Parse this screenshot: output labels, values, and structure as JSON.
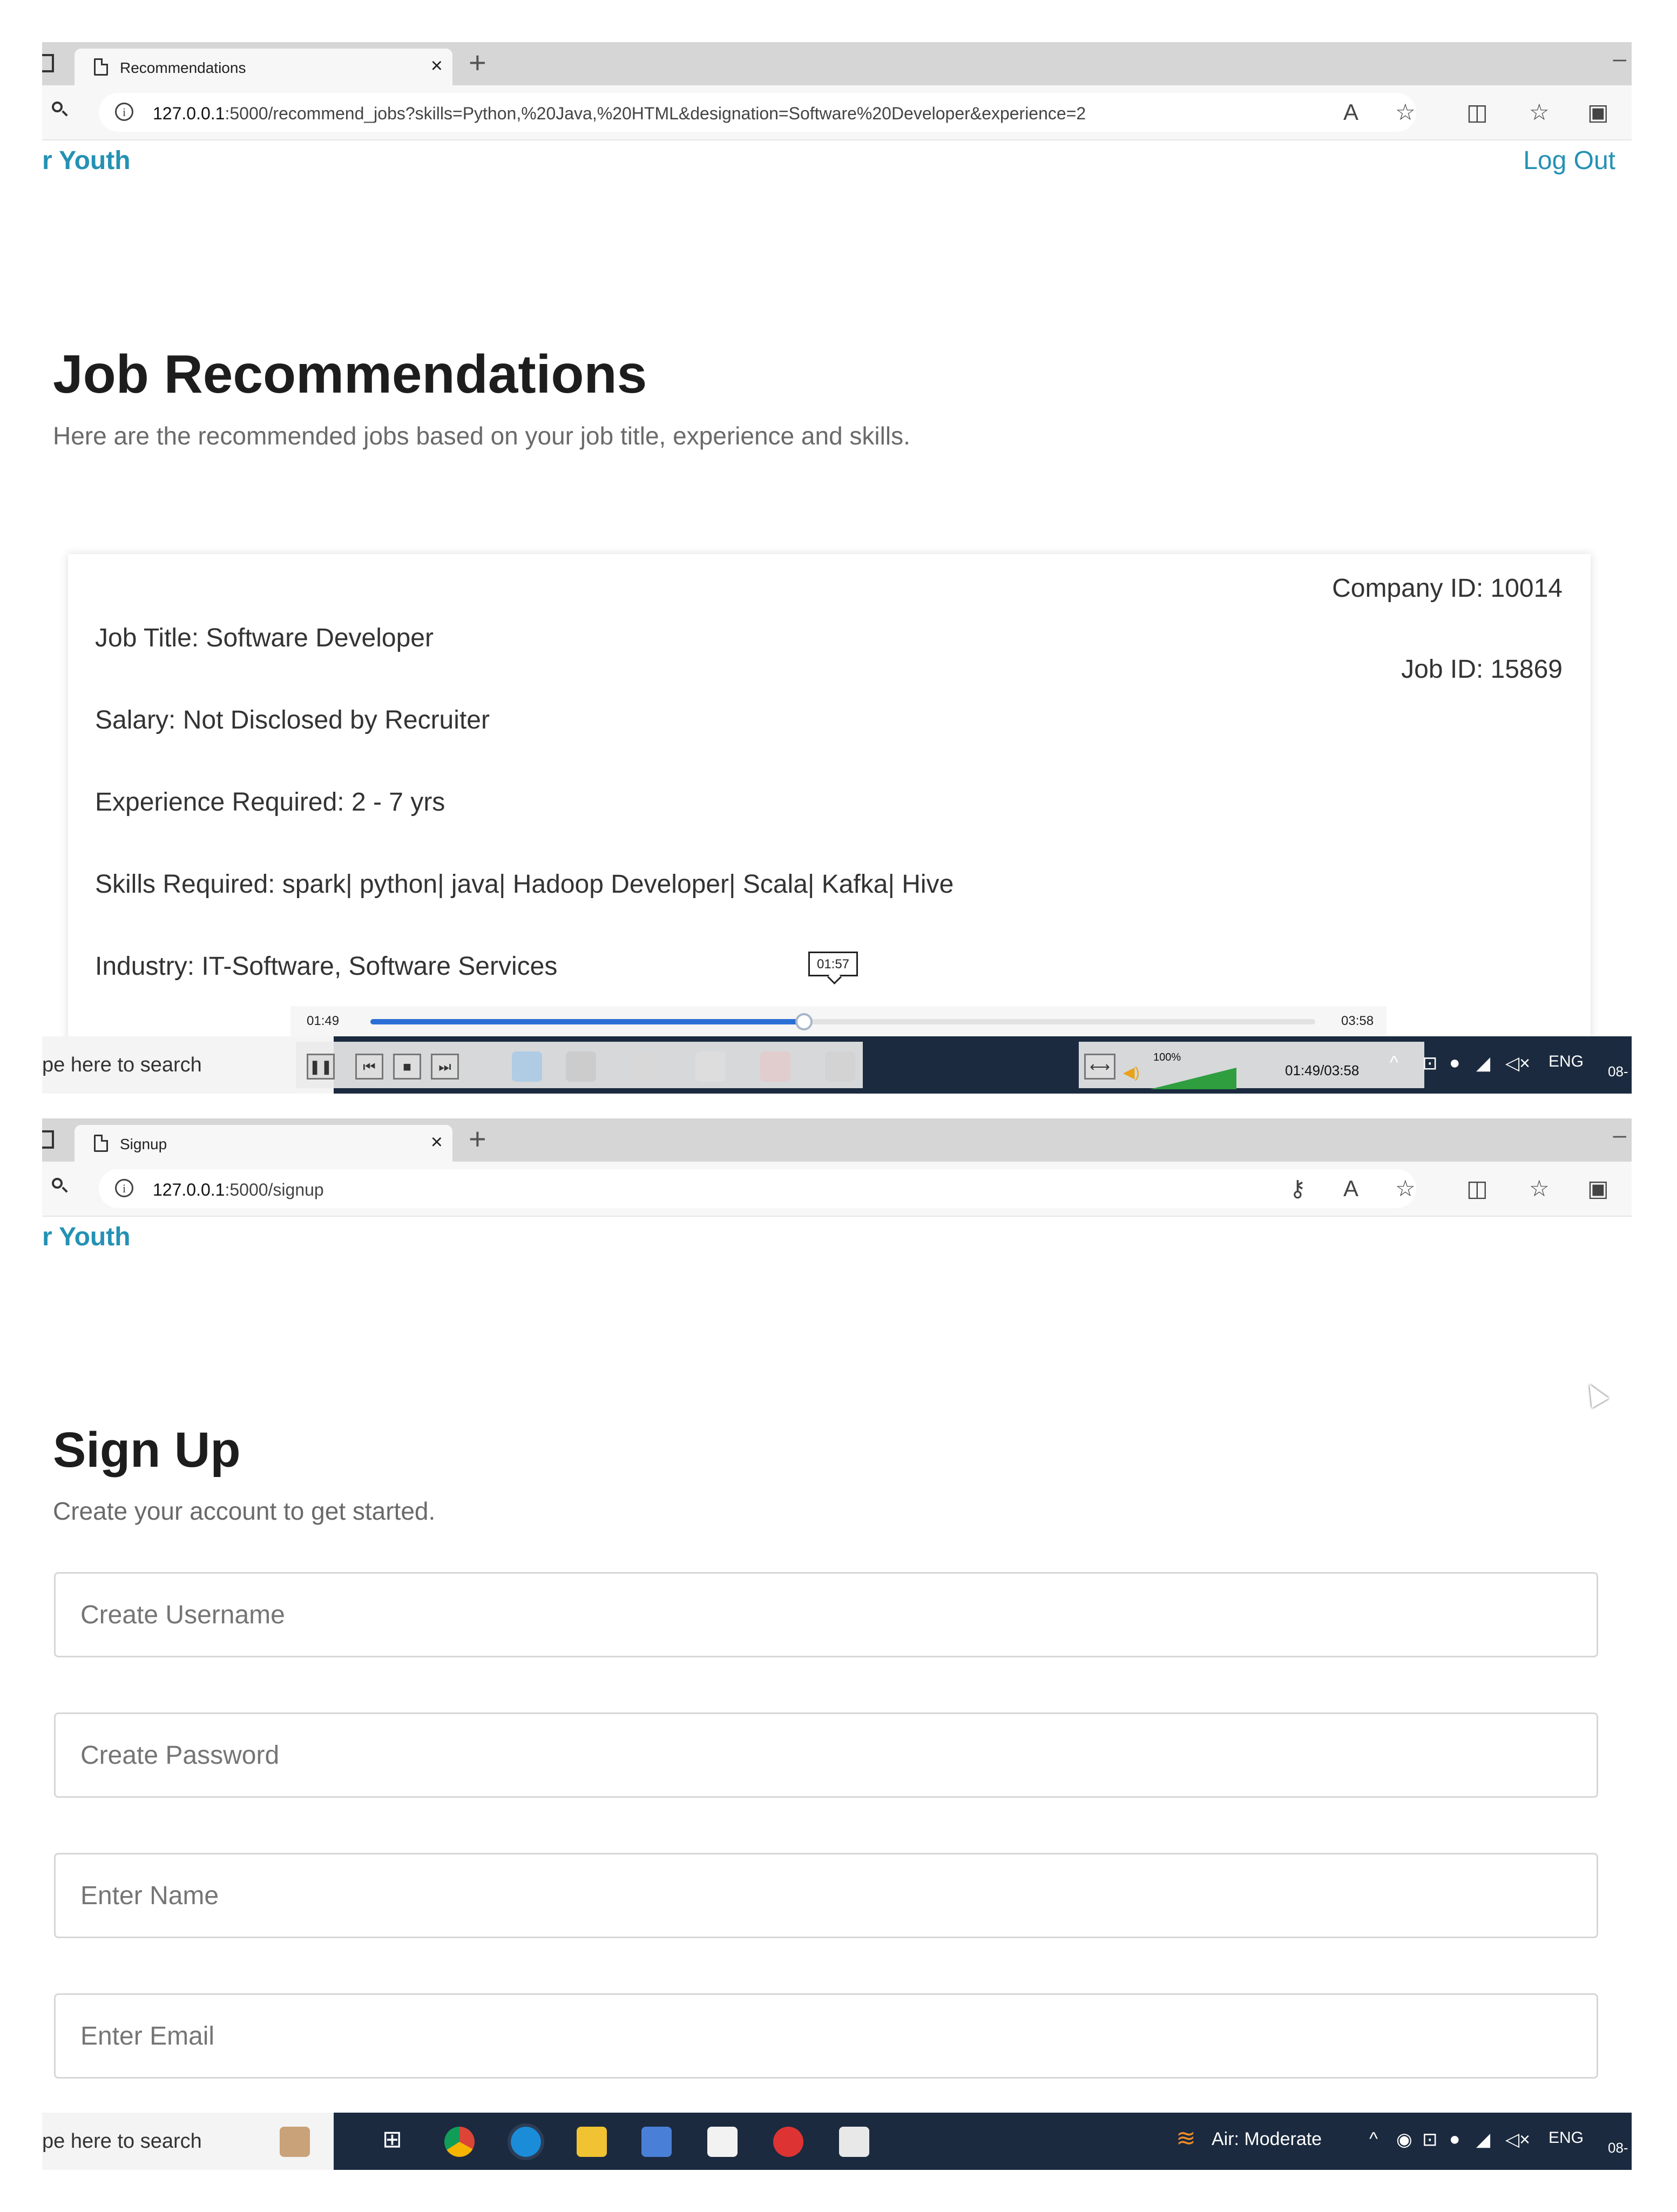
{
  "frame1": {
    "tab_title": "Recommendations",
    "url_host": "127.0.0.1",
    "url_rest": ":5000/recommend_jobs?skills=Python,%20Java,%20HTML&designation=Software%20Developer&experience=2",
    "brand": "r Youth",
    "logout": "Log Out",
    "heading": "Job Recommendations",
    "subheading": "Here are the recommended jobs based on your job title, experience and skills.",
    "job": {
      "company_id": "Company ID: 10014",
      "job_id": "Job ID: 15869",
      "title": "Job Title: Software Developer",
      "salary": "Salary: Not Disclosed by Recruiter",
      "experience": "Experience Required: 2 - 7 yrs",
      "skills": "Skills Required: spark| python| java| Hadoop Developer| Scala| Kafka| Hive",
      "industry": "Industry: IT-Software, Software Services"
    },
    "player": {
      "tooltip": "01:57",
      "current": "01:49",
      "total": "03:58",
      "progress": 0.459,
      "combined": "01:49/03:58",
      "volume_label": "100%"
    },
    "taskbar": {
      "search": "pe here to search",
      "lang": "ENG",
      "date": "08-"
    }
  },
  "frame2": {
    "tab_title": "Signup",
    "url_host": "127.0.0.1",
    "url_rest": ":5000/signup",
    "brand": "r Youth",
    "heading": "Sign Up",
    "subheading": "Create your account to get started.",
    "fields": {
      "username": "Create Username",
      "password": "Create Password",
      "name": "Enter Name",
      "email": "Enter Email"
    },
    "taskbar": {
      "search": "pe here to search",
      "air": "Air: Moderate",
      "lang": "ENG",
      "date": "08-"
    }
  },
  "colors": {
    "brand": "#2491b4",
    "taskbar": "#1b2a3f",
    "progress": "#2b6fd6"
  }
}
